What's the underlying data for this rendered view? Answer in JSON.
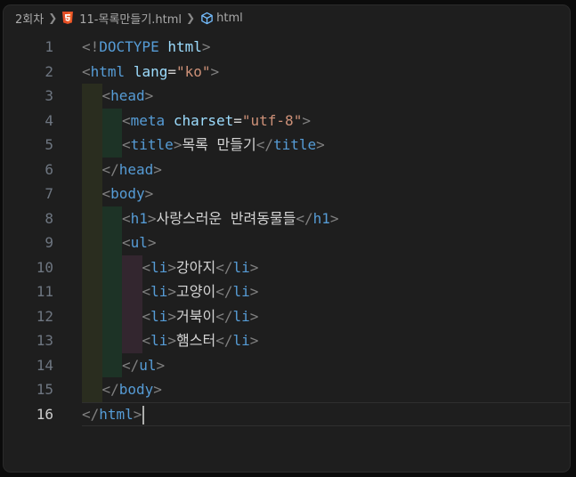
{
  "breadcrumb": {
    "folder": "2회차",
    "file_icon": "html5-icon",
    "file": "11-목록만들기.html",
    "symbol_icon": "symbol-element-icon",
    "symbol": "html"
  },
  "editor": {
    "language": "html",
    "current_line": 16,
    "lines": [
      {
        "n": "1",
        "indent": 0,
        "tokens": [
          {
            "t": "<!",
            "c": "punct"
          },
          {
            "t": "DOCTYPE",
            "c": "kw"
          },
          {
            "t": " ",
            "c": "text"
          },
          {
            "t": "html",
            "c": "attr"
          },
          {
            "t": ">",
            "c": "punct"
          }
        ]
      },
      {
        "n": "2",
        "indent": 0,
        "tokens": [
          {
            "t": "<",
            "c": "punct"
          },
          {
            "t": "html",
            "c": "tag"
          },
          {
            "t": " ",
            "c": "text"
          },
          {
            "t": "lang",
            "c": "attr"
          },
          {
            "t": "=",
            "c": "eq"
          },
          {
            "t": "\"ko\"",
            "c": "str"
          },
          {
            "t": ">",
            "c": "punct"
          }
        ]
      },
      {
        "n": "3",
        "indent": 1,
        "tokens": [
          {
            "t": "<",
            "c": "punct"
          },
          {
            "t": "head",
            "c": "tag"
          },
          {
            "t": ">",
            "c": "punct"
          }
        ]
      },
      {
        "n": "4",
        "indent": 2,
        "tokens": [
          {
            "t": "<",
            "c": "punct"
          },
          {
            "t": "meta",
            "c": "tag"
          },
          {
            "t": " ",
            "c": "text"
          },
          {
            "t": "charset",
            "c": "attr"
          },
          {
            "t": "=",
            "c": "eq"
          },
          {
            "t": "\"utf-8\"",
            "c": "str"
          },
          {
            "t": ">",
            "c": "punct"
          }
        ]
      },
      {
        "n": "5",
        "indent": 2,
        "tokens": [
          {
            "t": "<",
            "c": "punct"
          },
          {
            "t": "title",
            "c": "tag"
          },
          {
            "t": ">",
            "c": "punct"
          },
          {
            "t": "목록 만들기",
            "c": "text"
          },
          {
            "t": "</",
            "c": "punct"
          },
          {
            "t": "title",
            "c": "tag"
          },
          {
            "t": ">",
            "c": "punct"
          }
        ]
      },
      {
        "n": "6",
        "indent": 1,
        "tokens": [
          {
            "t": "</",
            "c": "punct"
          },
          {
            "t": "head",
            "c": "tag"
          },
          {
            "t": ">",
            "c": "punct"
          }
        ]
      },
      {
        "n": "7",
        "indent": 1,
        "tokens": [
          {
            "t": "<",
            "c": "punct"
          },
          {
            "t": "body",
            "c": "tag"
          },
          {
            "t": ">",
            "c": "punct"
          }
        ]
      },
      {
        "n": "8",
        "indent": 2,
        "tokens": [
          {
            "t": "<",
            "c": "punct"
          },
          {
            "t": "h1",
            "c": "tag"
          },
          {
            "t": ">",
            "c": "punct"
          },
          {
            "t": "사랑스러운 반려동물들",
            "c": "text"
          },
          {
            "t": "</",
            "c": "punct"
          },
          {
            "t": "h1",
            "c": "tag"
          },
          {
            "t": ">",
            "c": "punct"
          }
        ]
      },
      {
        "n": "9",
        "indent": 2,
        "tokens": [
          {
            "t": "<",
            "c": "punct"
          },
          {
            "t": "ul",
            "c": "tag"
          },
          {
            "t": ">",
            "c": "punct"
          }
        ]
      },
      {
        "n": "10",
        "indent": 3,
        "tokens": [
          {
            "t": "<",
            "c": "punct"
          },
          {
            "t": "li",
            "c": "tag"
          },
          {
            "t": ">",
            "c": "punct"
          },
          {
            "t": "강아지",
            "c": "text"
          },
          {
            "t": "</",
            "c": "punct"
          },
          {
            "t": "li",
            "c": "tag"
          },
          {
            "t": ">",
            "c": "punct"
          }
        ]
      },
      {
        "n": "11",
        "indent": 3,
        "tokens": [
          {
            "t": "<",
            "c": "punct"
          },
          {
            "t": "li",
            "c": "tag"
          },
          {
            "t": ">",
            "c": "punct"
          },
          {
            "t": "고양이",
            "c": "text"
          },
          {
            "t": "</",
            "c": "punct"
          },
          {
            "t": "li",
            "c": "tag"
          },
          {
            "t": ">",
            "c": "punct"
          }
        ]
      },
      {
        "n": "12",
        "indent": 3,
        "tokens": [
          {
            "t": "<",
            "c": "punct"
          },
          {
            "t": "li",
            "c": "tag"
          },
          {
            "t": ">",
            "c": "punct"
          },
          {
            "t": "거북이",
            "c": "text"
          },
          {
            "t": "</",
            "c": "punct"
          },
          {
            "t": "li",
            "c": "tag"
          },
          {
            "t": ">",
            "c": "punct"
          }
        ]
      },
      {
        "n": "13",
        "indent": 3,
        "tokens": [
          {
            "t": "<",
            "c": "punct"
          },
          {
            "t": "li",
            "c": "tag"
          },
          {
            "t": ">",
            "c": "punct"
          },
          {
            "t": "햄스터",
            "c": "text"
          },
          {
            "t": "</",
            "c": "punct"
          },
          {
            "t": "li",
            "c": "tag"
          },
          {
            "t": ">",
            "c": "punct"
          }
        ]
      },
      {
        "n": "14",
        "indent": 2,
        "tokens": [
          {
            "t": "</",
            "c": "punct"
          },
          {
            "t": "ul",
            "c": "tag"
          },
          {
            "t": ">",
            "c": "punct"
          }
        ]
      },
      {
        "n": "15",
        "indent": 1,
        "tokens": [
          {
            "t": "</",
            "c": "punct"
          },
          {
            "t": "body",
            "c": "tag"
          },
          {
            "t": ">",
            "c": "punct"
          }
        ]
      },
      {
        "n": "16",
        "indent": 0,
        "tokens": [
          {
            "t": "</",
            "c": "punct"
          },
          {
            "t": "html",
            "c": "tag"
          },
          {
            "t": ">",
            "c": "punct"
          }
        ]
      }
    ]
  },
  "colors": {
    "background": "#1e1e1e",
    "tag": "#569cd6",
    "attribute": "#9cdcfe",
    "string": "#ce9178",
    "punctuation": "#808080",
    "text": "#d4d4d4",
    "line_number": "#6e7681",
    "line_number_active": "#cccccc",
    "indent_guide_1": "#2a2d1f",
    "indent_guide_2": "#1d3326",
    "indent_guide_3": "#33262f"
  }
}
